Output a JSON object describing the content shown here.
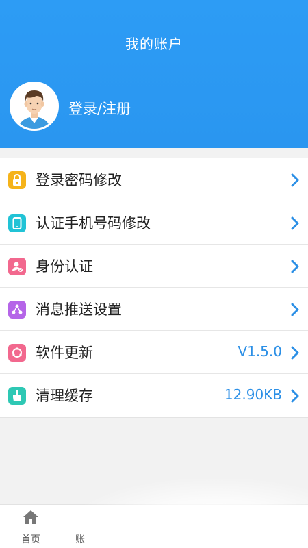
{
  "header": {
    "title": "我的账户",
    "login_label": "登录/注册"
  },
  "menu": {
    "items": [
      {
        "label": "登录密码修改",
        "value": "",
        "icon": "lock-icon",
        "color": "#f5b31a"
      },
      {
        "label": "认证手机号码修改",
        "value": "",
        "icon": "phone-icon",
        "color": "#21c3d6"
      },
      {
        "label": "身份认证",
        "value": "",
        "icon": "id-user-icon",
        "color": "#f2688e"
      },
      {
        "label": "消息推送设置",
        "value": "",
        "icon": "share-icon",
        "color": "#b565e8"
      },
      {
        "label": "软件更新",
        "value": "V1.5.0",
        "icon": "update-icon",
        "color": "#f2688e"
      },
      {
        "label": "清理缓存",
        "value": "12.90KB",
        "icon": "broom-icon",
        "color": "#2ec8b4"
      }
    ]
  },
  "tabbar": {
    "tabs": [
      {
        "label": "首页",
        "icon": "home-icon"
      },
      {
        "label": "账",
        "icon": ""
      }
    ]
  },
  "colors": {
    "header_blue": "#2d9cf5",
    "accent_value": "#2b8fe6"
  }
}
